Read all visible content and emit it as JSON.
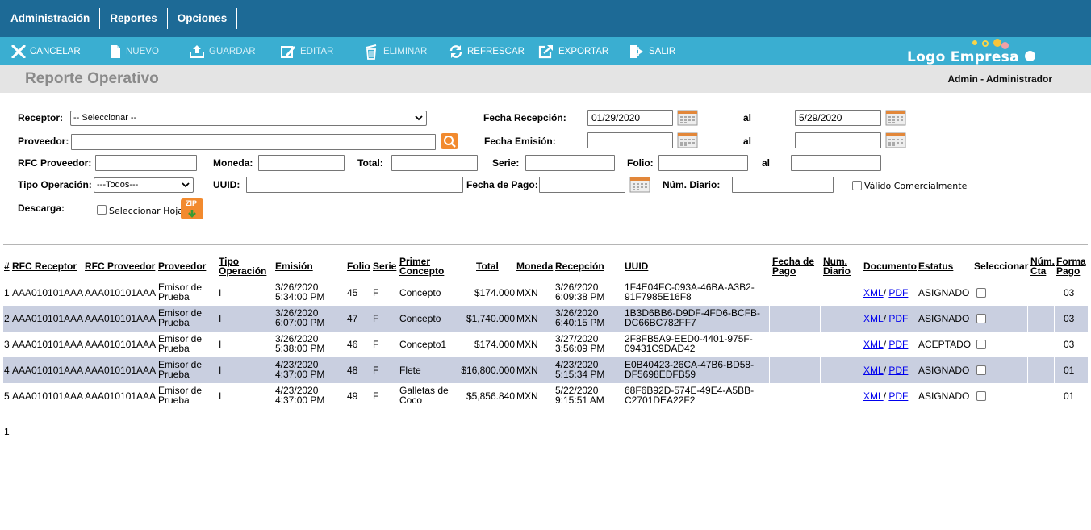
{
  "menu": [
    {
      "name": "menu-administracion",
      "label": "Administración"
    },
    {
      "name": "menu-reportes",
      "label": "Reportes"
    },
    {
      "name": "menu-opciones",
      "label": "Opciones"
    }
  ],
  "toolbar": {
    "cancelar": "CANCELAR",
    "nuevo": "NUEVO",
    "guardar": "GUARDAR",
    "editar": "EDITAR",
    "eliminar": "ELIMINAR",
    "refrescar": "REFRESCAR",
    "exportar": "EXPORTAR",
    "salir": "SALIR"
  },
  "logo": {
    "text": "Logo Empresa",
    "colors": [
      "#f7d54a",
      "#f7d54a",
      "#f7c43c",
      "#f2a0a6",
      "#ffffff"
    ]
  },
  "page": {
    "title": "Reporte Operativo",
    "user": "Admin - Administrador"
  },
  "form": {
    "receptor_label": "Receptor:",
    "receptor_value": "-- Seleccionar --",
    "proveedor_label": "Proveedor:",
    "proveedor_value": "",
    "fecha_recepcion_label": "Fecha Recepción:",
    "fecha_recepcion_from": "01/29/2020",
    "al": "al",
    "fecha_recepcion_to": "5/29/2020",
    "fecha_emision_label": "Fecha Emisión:",
    "fecha_emision_from": "",
    "fecha_emision_to": "",
    "rfc_proveedor_label": "RFC Proveedor:",
    "moneda_label": "Moneda:",
    "total_label": "Total:",
    "serie_label": "Serie:",
    "folio_label": "Folio:",
    "tipo_operacion_label": "Tipo Operación:",
    "tipo_operacion_value": "---Todos---",
    "uuid_label": "UUID:",
    "fecha_pago_label": "Fecha de Pago:",
    "num_diario_label": "Núm. Diario:",
    "valido_label": "Válido Comercialmente",
    "descarga_label": "Descarga:",
    "seleccionar_hoja_label": "Seleccionar Hoja",
    "zip_label": "ZIP"
  },
  "table": {
    "headers": {
      "num": "#",
      "rfc_receptor": "RFC Receptor",
      "rfc_proveedor": "RFC Proveedor",
      "proveedor": "Proveedor",
      "tipo_op_1": "Tipo",
      "tipo_op_2": "Operación",
      "emision": "Emisión",
      "folio": "Folio",
      "serie": "Serie",
      "concepto_1": "Primer",
      "concepto_2": "Concepto",
      "total": "Total",
      "moneda": "Moneda",
      "recepcion": "Recepción",
      "uuid": "UUID",
      "fecha_pago_1": "Fecha de",
      "fecha_pago_2": "Pago",
      "num_diario_1": "Num.",
      "num_diario_2": "Diario",
      "documento": "Documento",
      "estatus": "Estatus",
      "seleccionar": "Seleccionar",
      "num_cta_1": "Núm.",
      "num_cta_2": "Cta",
      "forma_pago_1": "Forma",
      "forma_pago_2": "Pago"
    },
    "rows": [
      {
        "num": "1",
        "rfc_receptor": "AAA010101AAA",
        "rfc_proveedor": "AAA010101AAA",
        "proveedor_1": "Emisor de",
        "proveedor_2": "Prueba",
        "tipo": "I",
        "emision_1": "3/26/2020",
        "emision_2": "5:34:00 PM",
        "folio": "45",
        "serie": "F",
        "concepto_1": "Concepto",
        "concepto_2": "",
        "total": "$174.000",
        "moneda": "MXN",
        "recepcion_1": "3/26/2020",
        "recepcion_2": "6:09:38 PM",
        "uuid_1": "1F4E04FC-093A-46BA-A3B2-",
        "uuid_2": "91F7985E16F8",
        "xml": "XML",
        "slash": "/",
        "pdf": "PDF",
        "estatus": "ASIGNADO",
        "forma_pago": "03"
      },
      {
        "num": "2",
        "rfc_receptor": "AAA010101AAA",
        "rfc_proveedor": "AAA010101AAA",
        "proveedor_1": "Emisor de",
        "proveedor_2": "Prueba",
        "tipo": "I",
        "emision_1": "3/26/2020",
        "emision_2": "6:07:00 PM",
        "folio": "47",
        "serie": "F",
        "concepto_1": "Concepto",
        "concepto_2": "",
        "total": "$1,740.000",
        "moneda": "MXN",
        "recepcion_1": "3/26/2020",
        "recepcion_2": "6:40:15 PM",
        "uuid_1": "1B3D6BB6-D9DF-4FD6-BCFB-",
        "uuid_2": "DC66BC782FF7",
        "xml": "XML",
        "slash": "/",
        "pdf": "PDF",
        "estatus": "ASIGNADO",
        "forma_pago": "03"
      },
      {
        "num": "3",
        "rfc_receptor": "AAA010101AAA",
        "rfc_proveedor": "AAA010101AAA",
        "proveedor_1": "Emisor de",
        "proveedor_2": "Prueba",
        "tipo": "I",
        "emision_1": "3/26/2020",
        "emision_2": "5:38:00 PM",
        "folio": "46",
        "serie": "F",
        "concepto_1": "Concepto1",
        "concepto_2": "",
        "total": "$174.000",
        "moneda": "MXN",
        "recepcion_1": "3/27/2020",
        "recepcion_2": "3:56:09 PM",
        "uuid_1": "2F8FB5A9-EED0-4401-975F-",
        "uuid_2": "09431C9DAD42",
        "xml": "XML",
        "slash": "/",
        "pdf": "PDF",
        "estatus": "ACEPTADO",
        "forma_pago": "03"
      },
      {
        "num": "4",
        "rfc_receptor": "AAA010101AAA",
        "rfc_proveedor": "AAA010101AAA",
        "proveedor_1": "Emisor de",
        "proveedor_2": "Prueba",
        "tipo": "I",
        "emision_1": "4/23/2020",
        "emision_2": "4:37:00 PM",
        "folio": "48",
        "serie": "F",
        "concepto_1": "Flete",
        "concepto_2": "",
        "total": "$16,800.000",
        "moneda": "MXN",
        "recepcion_1": "4/23/2020",
        "recepcion_2": "5:15:34 PM",
        "uuid_1": "E0B40423-26CA-47B6-BD58-",
        "uuid_2": "DF5698EDFB59",
        "xml": "XML",
        "slash": "/",
        "pdf": "PDF",
        "estatus": "ASIGNADO",
        "forma_pago": "01"
      },
      {
        "num": "5",
        "rfc_receptor": "AAA010101AAA",
        "rfc_proveedor": "AAA010101AAA",
        "proveedor_1": "Emisor de",
        "proveedor_2": "Prueba",
        "tipo": "I",
        "emision_1": "4/23/2020",
        "emision_2": "4:37:00 PM",
        "folio": "49",
        "serie": "F",
        "concepto_1": "Galletas de",
        "concepto_2": "Coco",
        "total": "$5,856.840",
        "moneda": "MXN",
        "recepcion_1": "5/22/2020",
        "recepcion_2": "9:15:51 AM",
        "uuid_1": "68F6B92D-574E-49E4-A5BB-",
        "uuid_2": "C2701DEA22F2",
        "xml": "XML",
        "slash": "/",
        "pdf": "PDF",
        "estatus": "ASIGNADO",
        "forma_pago": "01"
      }
    ]
  },
  "pager": {
    "current": "1"
  }
}
